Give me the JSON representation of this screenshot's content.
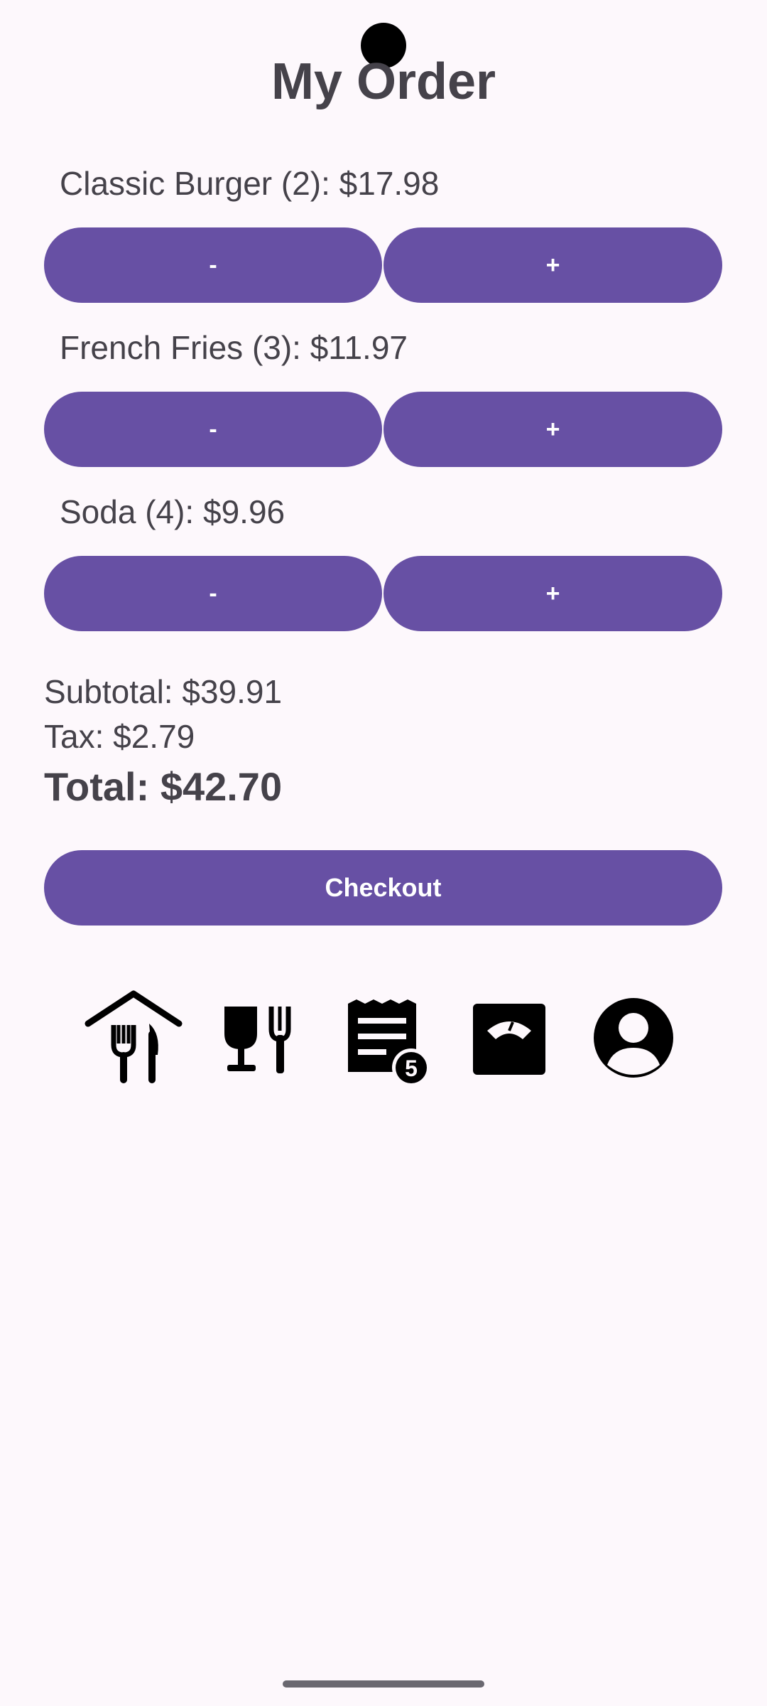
{
  "page": {
    "title": "My Order"
  },
  "items": [
    {
      "label": "Classic Burger (2): $17.98",
      "minus_label": "-",
      "plus_label": "+"
    },
    {
      "label": "French Fries (3): $11.97",
      "minus_label": "-",
      "plus_label": "+"
    },
    {
      "label": "Soda (4): $9.96",
      "minus_label": "-",
      "plus_label": "+"
    }
  ],
  "summary": {
    "subtotal": "Subtotal: $39.91",
    "tax": "Tax: $2.79",
    "total": "Total: $42.70"
  },
  "checkout": {
    "label": "Checkout"
  },
  "nav": {
    "icons": [
      "restaurant-home-icon",
      "dining-icon",
      "order-list-icon",
      "scale-icon",
      "account-icon"
    ],
    "orders_badge": "5"
  },
  "colors": {
    "accent": "#6750a4",
    "background": "#fdf8fc",
    "text": "#45424a"
  }
}
